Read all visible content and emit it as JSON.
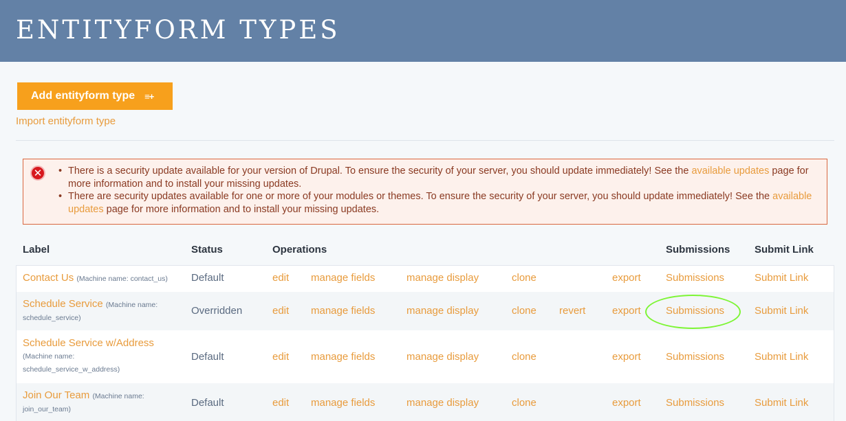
{
  "page": {
    "title": "ENTITYFORM TYPES"
  },
  "actions": {
    "add_label": "Add entityform type",
    "add_icon": "list-add-icon",
    "import_label": "Import entityform type"
  },
  "alert": {
    "items": [
      {
        "before": "There is a security update available for your version of Drupal. To ensure the security of your server, you should update immediately! See the ",
        "link": "available updates",
        "after": " page for more information and to install your missing updates."
      },
      {
        "before": "There are security updates available for one or more of your modules or themes. To ensure the security of your server, you should update immediately! See the ",
        "link": "available updates",
        "after": " page for more information and to install your missing updates."
      }
    ]
  },
  "table": {
    "headers": {
      "label": "Label",
      "status": "Status",
      "operations": "Operations",
      "submissions": "Submissions",
      "submit_link": "Submit Link"
    },
    "rows": [
      {
        "name": "Contact Us",
        "machine": "(Machine name: contact_us)",
        "status": "Default",
        "edit": "edit",
        "fields": "manage fields",
        "display": "manage display",
        "clone": "clone",
        "revert": "",
        "export": "export",
        "submissions": "Submissions",
        "submit_link": "Submit Link"
      },
      {
        "name": "Schedule Service",
        "machine_a": "(Machine name:",
        "machine_b": "schedule_service)",
        "status": "Overridden",
        "edit": "edit",
        "fields": "manage fields",
        "display": "manage display",
        "clone": "clone",
        "revert": "revert",
        "export": "export",
        "submissions": "Submissions",
        "submit_link": "Submit Link"
      },
      {
        "name": "Schedule Service w/Address",
        "machine_a": "(Machine name:",
        "machine_b": "schedule_service_w_address)",
        "status": "Default",
        "edit": "edit",
        "fields": "manage fields",
        "display": "manage display",
        "clone": "clone",
        "revert": "",
        "export": "export",
        "submissions": "Submissions",
        "submit_link": "Submit Link"
      },
      {
        "name": "Join Our Team",
        "machine_a": "(Machine name:",
        "machine_b": "join_our_team)",
        "status": "Default",
        "edit": "edit",
        "fields": "manage fields",
        "display": "manage display",
        "clone": "clone",
        "revert": "",
        "export": "export",
        "submissions": "Submissions",
        "submit_link": "Submit Link"
      }
    ]
  },
  "colors": {
    "header_bg": "#6381a6",
    "accent": "#f7a01c",
    "link": "#e89b3c",
    "error": "#d7181e",
    "highlight": "#7df534"
  }
}
